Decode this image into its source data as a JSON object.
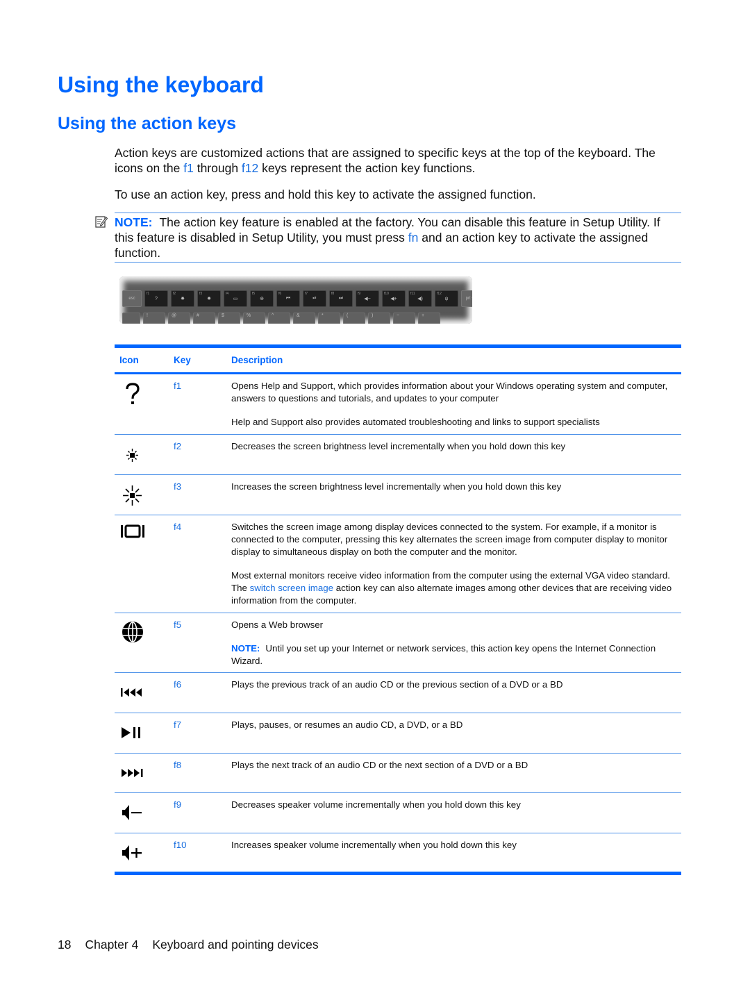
{
  "title": "Using the keyboard",
  "subtitle": "Using the action keys",
  "intro": {
    "p1_part1": "Action keys are customized actions that are assigned to specific keys at the top of the keyboard. The icons on the ",
    "p1_f1": "f1",
    "p1_part2": " through ",
    "p1_f12": "f12",
    "p1_part3": " keys represent the action key functions.",
    "p2": "To use an action key, press and hold this key to activate the assigned function."
  },
  "note": {
    "label": "NOTE:",
    "part1": "The action key feature is enabled at the factory. You can disable this feature in Setup Utility. If this feature is disabled in Setup Utility, you must press ",
    "fn": "fn",
    "part2": " and an action key to activate the assigned function."
  },
  "keyboard_image": {
    "esc": "esc",
    "prt": "prt sc",
    "fkeys": [
      "f1",
      "f2",
      "f3",
      "f4",
      "f5",
      "f6",
      "f7",
      "f8",
      "f9",
      "f10",
      "f11",
      "f12"
    ],
    "fkey_glyphs": [
      "?",
      "✸",
      "✹",
      "▭",
      "⊕",
      "⏮",
      "⏯",
      "⏭",
      "◀−",
      "◀+",
      "◀)",
      "ψ"
    ],
    "number_row": [
      "!",
      "@",
      "#",
      "$",
      "%",
      "^",
      "&",
      "*",
      "(",
      ")",
      "−",
      "+"
    ]
  },
  "table": {
    "headers": {
      "icon": "Icon",
      "key": "Key",
      "description": "Description"
    },
    "rows": [
      {
        "icon": "help-question-icon",
        "key": "f1",
        "desc": [
          "Opens Help and Support, which provides information about your Windows operating system and computer, answers to questions and tutorials, and updates to your computer",
          "Help and Support also provides automated troubleshooting and links to support specialists"
        ]
      },
      {
        "icon": "brightness-down-icon",
        "key": "f2",
        "desc": [
          "Decreases the screen brightness level incrementally when you hold down this key"
        ]
      },
      {
        "icon": "brightness-up-icon",
        "key": "f3",
        "desc": [
          "Increases the screen brightness level incrementally when you hold down this key"
        ]
      },
      {
        "icon": "switch-screen-icon",
        "key": "f4",
        "desc": [
          "Switches the screen image among display devices connected to the system. For example, if a monitor is connected to the computer, pressing this key alternates the screen image from computer display to monitor display to simultaneous display on both the computer and the monitor."
        ],
        "desc2_part1": "Most external monitors receive video information from the computer using the external VGA video standard. The ",
        "desc2_link": "switch screen image",
        "desc2_part2": " action key can also alternate images among other devices that are receiving video information from the computer."
      },
      {
        "icon": "web-browser-globe-icon",
        "key": "f5",
        "desc": [
          "Opens a Web browser"
        ],
        "note_label": "NOTE:",
        "note_text": "Until you set up your Internet or network services, this action key opens the Internet Connection Wizard."
      },
      {
        "icon": "previous-track-icon",
        "key": "f6",
        "desc": [
          "Plays the previous track of an audio CD or the previous section of a DVD or a BD"
        ]
      },
      {
        "icon": "play-pause-icon",
        "key": "f7",
        "desc": [
          "Plays, pauses, or resumes an audio CD, a DVD, or a BD"
        ]
      },
      {
        "icon": "next-track-icon",
        "key": "f8",
        "desc": [
          "Plays the next track of an audio CD or the next section of a DVD or a BD"
        ]
      },
      {
        "icon": "volume-down-icon",
        "key": "f9",
        "desc": [
          "Decreases speaker volume incrementally when you hold down this key"
        ]
      },
      {
        "icon": "volume-up-icon",
        "key": "f10",
        "desc": [
          "Increases speaker volume incrementally when you hold down this key"
        ]
      }
    ]
  },
  "footer": {
    "page_number": "18",
    "chapter": "Chapter 4",
    "chapter_title": "Keyboard and pointing devices"
  },
  "colors": {
    "heading_blue": "#0066ff",
    "link_blue": "#1a6fe0",
    "rule_blue": "#4a90e8"
  }
}
